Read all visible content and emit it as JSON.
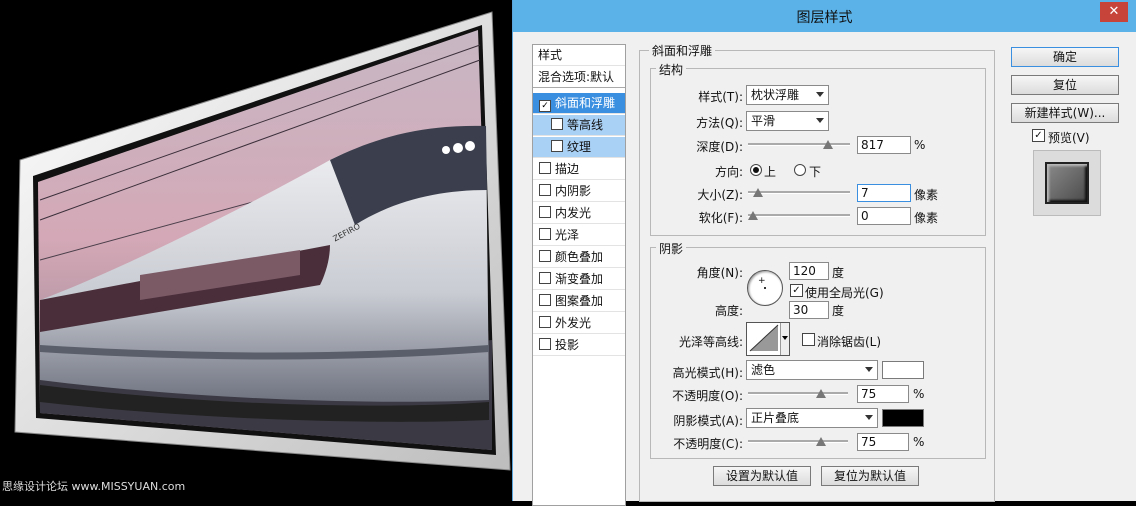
{
  "watermark": "思缘设计论坛 www.MISSYUAN.com",
  "train_label": "ZEFIRO",
  "dialog": {
    "title": "图层样式",
    "close_symbol": "✕"
  },
  "style_list": {
    "header": "样式",
    "blend_options": "混合选项:默认",
    "items": [
      {
        "label": "斜面和浮雕",
        "checked": true
      },
      {
        "label": "等高线",
        "checked": false
      },
      {
        "label": "纹理",
        "checked": false
      },
      {
        "label": "描边",
        "checked": false
      },
      {
        "label": "内阴影",
        "checked": false
      },
      {
        "label": "内发光",
        "checked": false
      },
      {
        "label": "光泽",
        "checked": false
      },
      {
        "label": "颜色叠加",
        "checked": false
      },
      {
        "label": "渐变叠加",
        "checked": false
      },
      {
        "label": "图案叠加",
        "checked": false
      },
      {
        "label": "外发光",
        "checked": false
      },
      {
        "label": "投影",
        "checked": false
      }
    ],
    "check_mark": "✓"
  },
  "bevel": {
    "title": "斜面和浮雕",
    "structure": {
      "title": "结构",
      "style_label": "样式(T):",
      "style_value": "枕状浮雕",
      "technique_label": "方法(Q):",
      "technique_value": "平滑",
      "depth_label": "深度(D):",
      "depth_value": "817",
      "depth_slider": 0.82,
      "depth_unit": "%",
      "direction_label": "方向:",
      "direction_up": "上",
      "direction_down": "下",
      "size_label": "大小(Z):",
      "size_value": "7",
      "size_slider": 0.05,
      "size_unit": "像素",
      "soften_label": "软化(F):",
      "soften_value": "0",
      "soften_slider": 0.0,
      "soften_unit": "像素"
    },
    "shading": {
      "title": "阴影",
      "angle_label": "角度(N):",
      "angle_value": "120",
      "angle_unit": "度",
      "global_light_label": "使用全局光(G)",
      "altitude_label": "高度:",
      "altitude_value": "30",
      "altitude_unit": "度",
      "gloss_label": "光泽等高线:",
      "antialias_label": "消除锯齿(L)",
      "highlight_mode_label": "高光模式(H):",
      "highlight_mode_value": "滤色",
      "highlight_color": "#ffffff",
      "highlight_opacity_label": "不透明度(O):",
      "highlight_opacity_value": "75",
      "highlight_opacity_slider": 0.75,
      "shadow_mode_label": "阴影模式(A):",
      "shadow_mode_value": "正片叠底",
      "shadow_color": "#000000",
      "shadow_opacity_label": "不透明度(C):",
      "shadow_opacity_value": "75",
      "shadow_opacity_slider": 0.75,
      "percent": "%"
    },
    "make_default": "设置为默认值",
    "reset_default": "复位为默认值"
  },
  "buttons": {
    "ok": "确定",
    "reset": "复位",
    "new_style": "新建样式(W)...",
    "preview_label": "预览(V)"
  }
}
